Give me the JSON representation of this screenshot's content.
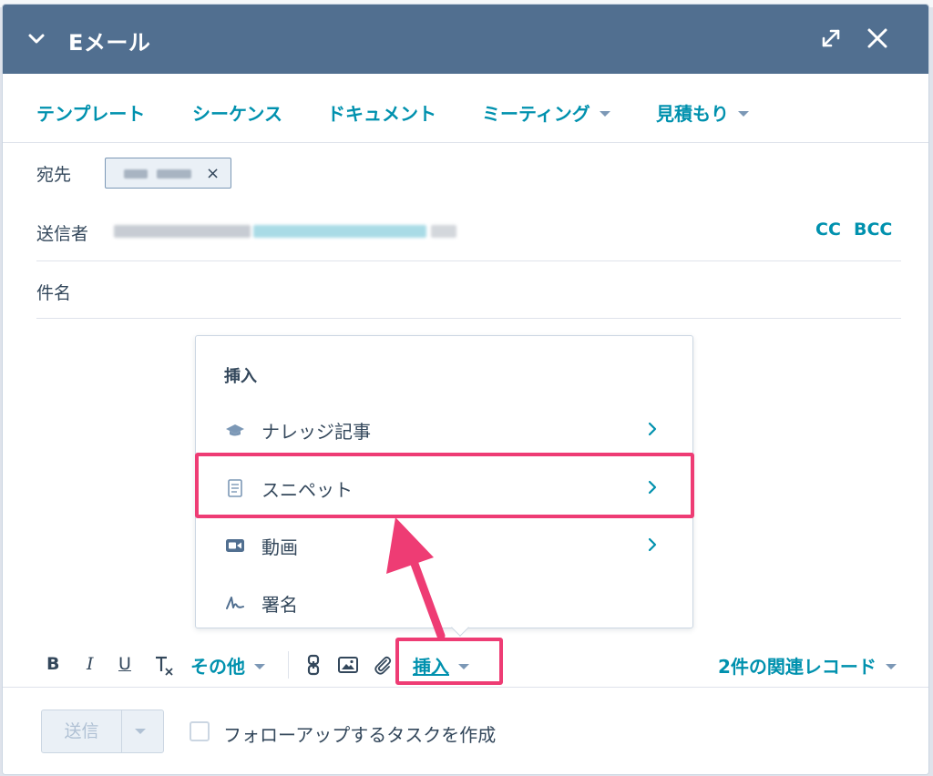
{
  "header": {
    "title": "Eメール",
    "bg_color": "#516f90",
    "icons": [
      "chevron-down-icon",
      "expand-icon",
      "close-icon"
    ]
  },
  "tools": {
    "items": [
      {
        "label": "テンプレート",
        "has_caret": false
      },
      {
        "label": "シーケンス",
        "has_caret": false
      },
      {
        "label": "ドキュメント",
        "has_caret": false
      },
      {
        "label": "ミーティング",
        "has_caret": true
      },
      {
        "label": "見積もり",
        "has_caret": true
      }
    ],
    "accent": "#0091ae"
  },
  "fields": {
    "to_label": "宛先",
    "to_chip_remove": "×",
    "from_label": "送信者",
    "cc": "CC",
    "bcc": "BCC",
    "subject_label": "件名"
  },
  "insert_menu": {
    "header": "挿入",
    "items": [
      {
        "label": "ナレッジ記事",
        "icon": "graduation-cap-icon",
        "has_submenu": true
      },
      {
        "label": "スニペット",
        "icon": "document-icon",
        "has_submenu": true,
        "highlighted": true
      },
      {
        "label": "動画",
        "icon": "video-icon",
        "has_submenu": true
      },
      {
        "label": "署名",
        "icon": "signature-icon",
        "has_submenu": false
      }
    ]
  },
  "toolbar": {
    "bold": "B",
    "italic": "I",
    "underline": "U",
    "more_label": "その他",
    "insert_label": "挿入",
    "associations_label": "2件の関連レコード"
  },
  "footer": {
    "send_label": "送信",
    "followup_label": "フォローアップするタスクを作成"
  },
  "annotation": {
    "highlight_color": "#ee3c74"
  }
}
